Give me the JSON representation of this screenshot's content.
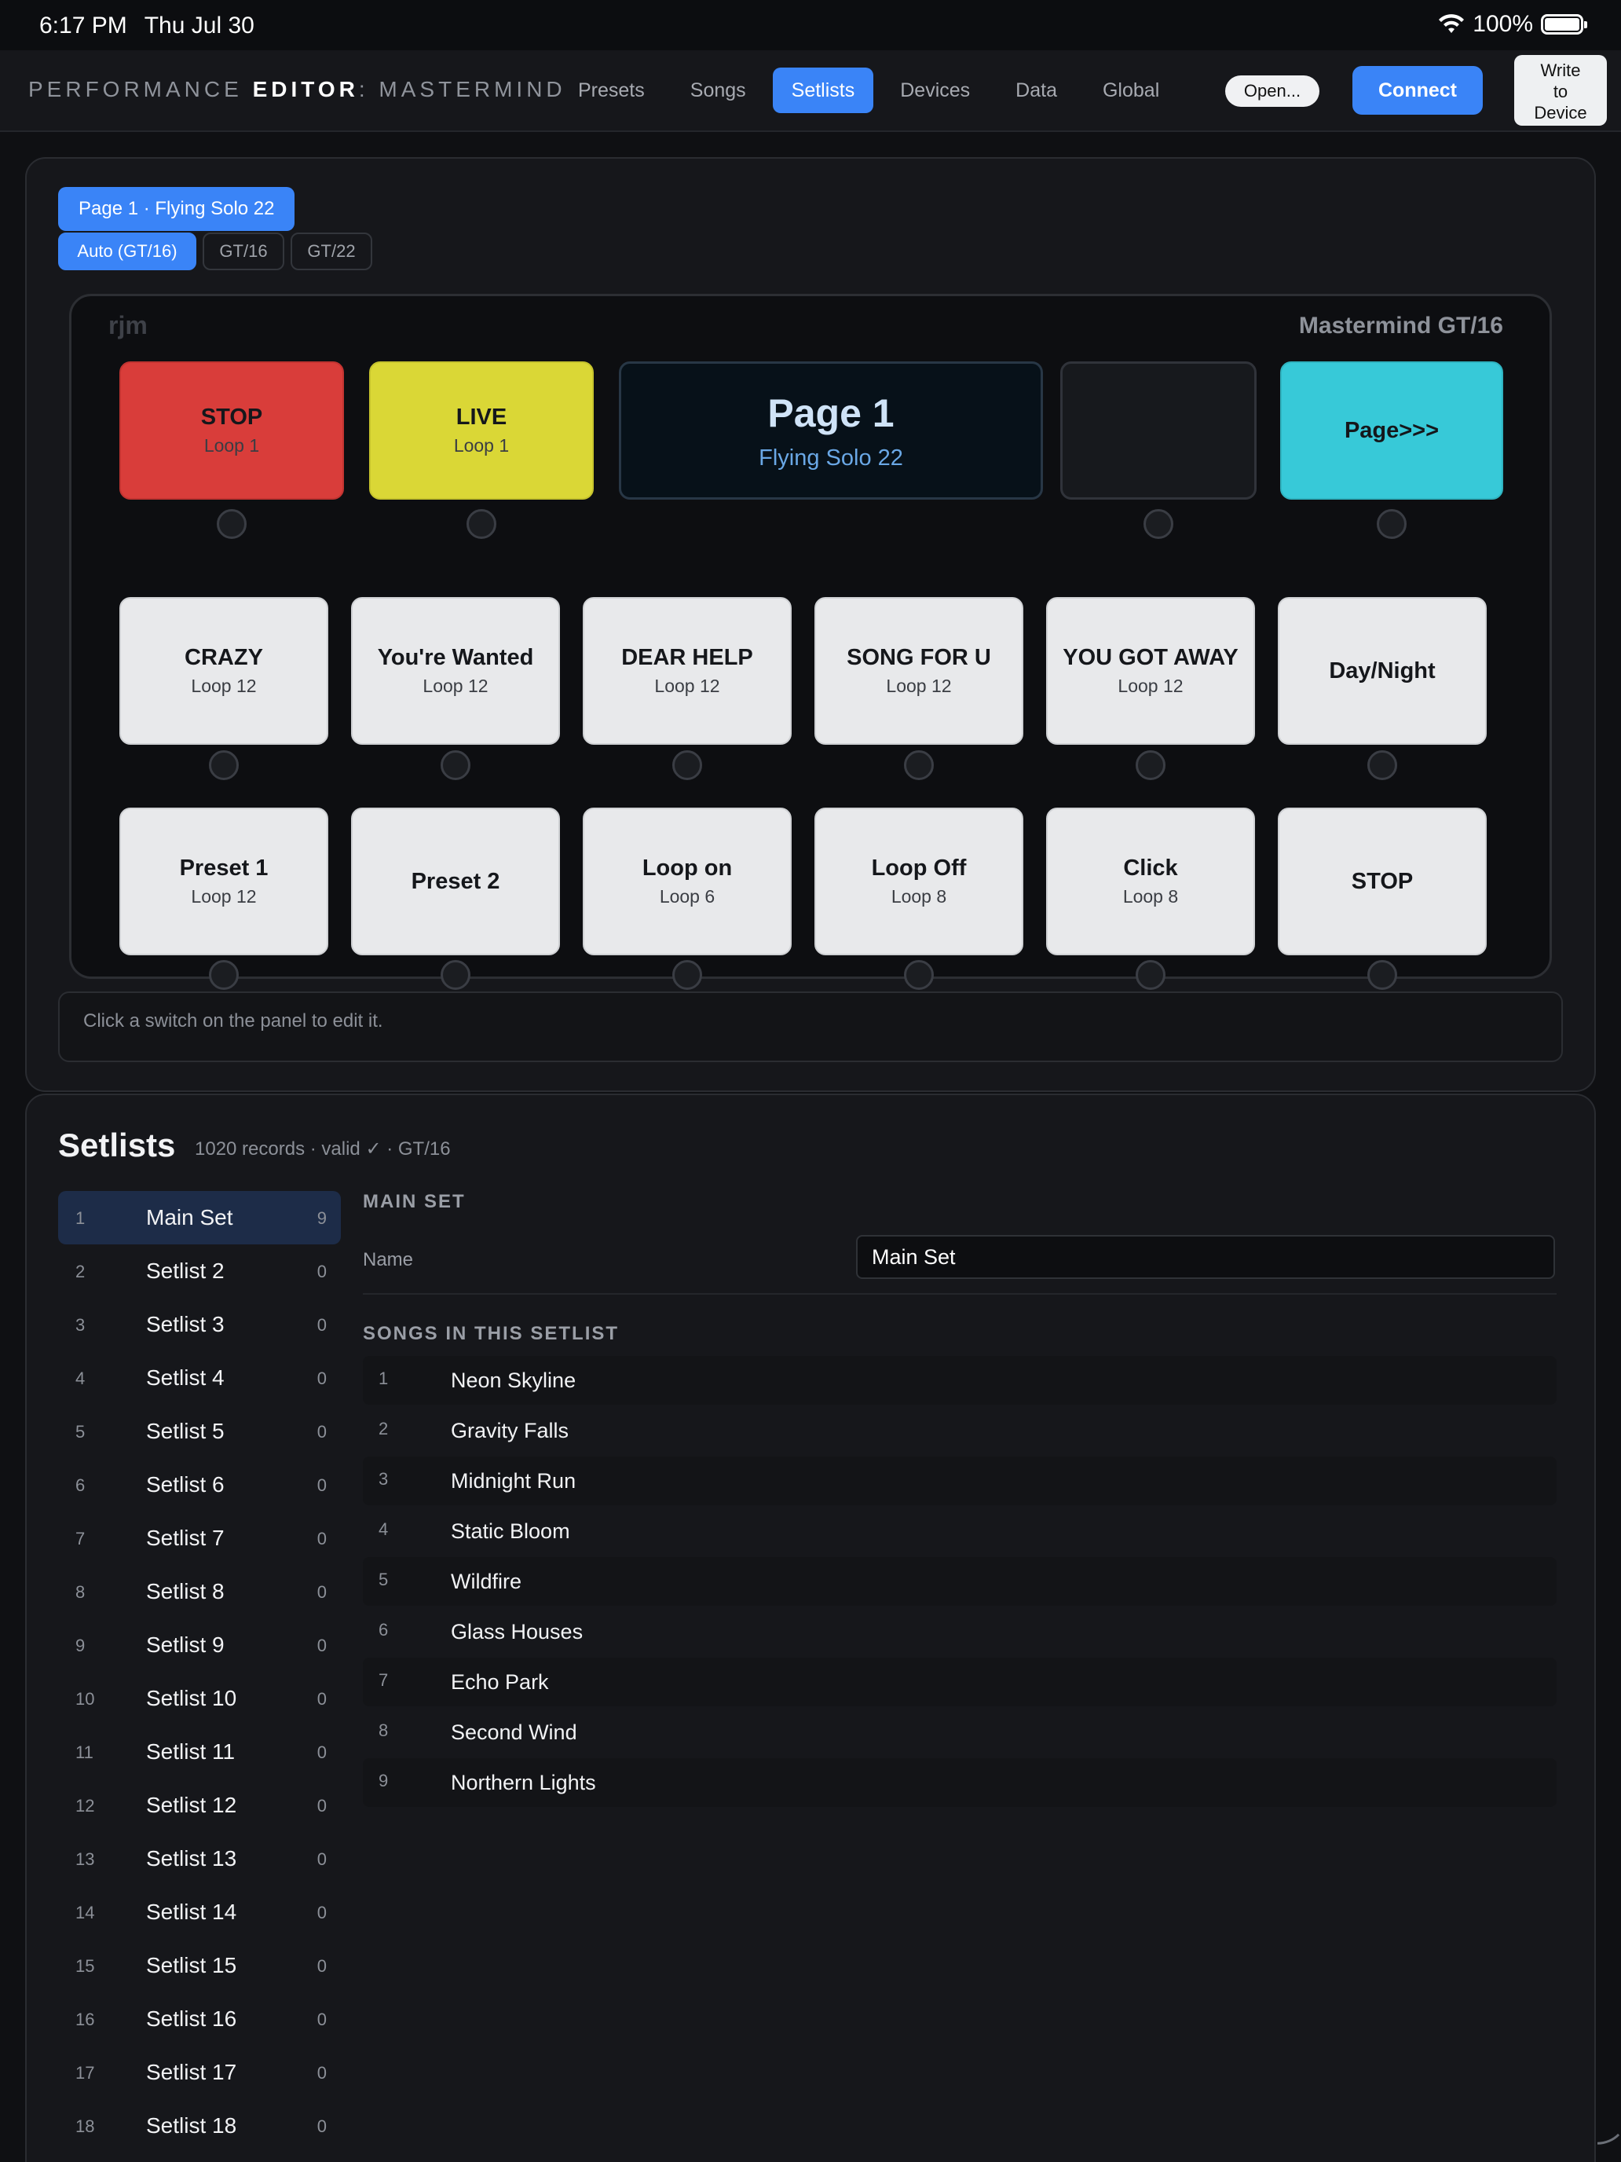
{
  "status": {
    "time": "6:17 PM",
    "date": "Thu Jul 30",
    "battery": "100%"
  },
  "app": {
    "brand_prefix": "PERFORMANCE ",
    "brand_bold": "EDITOR",
    "brand_suffix": ": MASTERMIND"
  },
  "nav": {
    "tabs": [
      "Presets",
      "Songs",
      "Setlists",
      "Devices",
      "Data",
      "Global"
    ],
    "active": "Setlists"
  },
  "actions": {
    "open": "Open...",
    "connect": "Connect",
    "write": "Write\nto\nDevice"
  },
  "panel": {
    "page_chip": "Page 1 · Flying Solo 22",
    "layouts": [
      "Auto (GT/16)",
      "GT/16",
      "GT/22"
    ],
    "brand": "rjm",
    "model": "Mastermind GT/16",
    "top_row": [
      {
        "title": "STOP",
        "sub": "Loop 1",
        "color": "#d93d3a"
      },
      {
        "title": "LIVE",
        "sub": "Loop 1",
        "color": "#dad736"
      },
      {
        "title": "Page 1",
        "sub": "Flying Solo 22",
        "kind": "display"
      },
      {
        "title": "",
        "sub": "",
        "kind": "empty"
      },
      {
        "title": "Page>>>",
        "sub": "",
        "color": "#37c9d8"
      }
    ],
    "row2": [
      {
        "title": "CRAZY",
        "sub": "Loop 12"
      },
      {
        "title": "You're Wanted",
        "sub": "Loop 12"
      },
      {
        "title": "DEAR HELP",
        "sub": "Loop 12"
      },
      {
        "title": "SONG FOR U",
        "sub": "Loop 12"
      },
      {
        "title": "YOU GOT AWAY",
        "sub": "Loop 12"
      },
      {
        "title": "Day/Night",
        "sub": ""
      }
    ],
    "row3": [
      {
        "title": "Preset 1",
        "sub": "Loop 12"
      },
      {
        "title": "Preset 2",
        "sub": ""
      },
      {
        "title": "Loop on",
        "sub": "Loop 6"
      },
      {
        "title": "Loop Off",
        "sub": "Loop 8"
      },
      {
        "title": "Click",
        "sub": "Loop 8"
      },
      {
        "title": "STOP",
        "sub": ""
      }
    ],
    "hint": "Click a switch on the panel to edit it."
  },
  "setlists": {
    "title": "Setlists",
    "meta": "1020 records · valid ✓ · GT/16",
    "items": [
      {
        "num": "1",
        "name": "Main Set",
        "count": "9"
      },
      {
        "num": "2",
        "name": "Setlist 2",
        "count": "0"
      },
      {
        "num": "3",
        "name": "Setlist 3",
        "count": "0"
      },
      {
        "num": "4",
        "name": "Setlist 4",
        "count": "0"
      },
      {
        "num": "5",
        "name": "Setlist 5",
        "count": "0"
      },
      {
        "num": "6",
        "name": "Setlist 6",
        "count": "0"
      },
      {
        "num": "7",
        "name": "Setlist 7",
        "count": "0"
      },
      {
        "num": "8",
        "name": "Setlist 8",
        "count": "0"
      },
      {
        "num": "9",
        "name": "Setlist 9",
        "count": "0"
      },
      {
        "num": "10",
        "name": "Setlist 10",
        "count": "0"
      },
      {
        "num": "11",
        "name": "Setlist 11",
        "count": "0"
      },
      {
        "num": "12",
        "name": "Setlist 12",
        "count": "0"
      },
      {
        "num": "13",
        "name": "Setlist 13",
        "count": "0"
      },
      {
        "num": "14",
        "name": "Setlist 14",
        "count": "0"
      },
      {
        "num": "15",
        "name": "Setlist 15",
        "count": "0"
      },
      {
        "num": "16",
        "name": "Setlist 16",
        "count": "0"
      },
      {
        "num": "17",
        "name": "Setlist 17",
        "count": "0"
      },
      {
        "num": "18",
        "name": "Setlist 18",
        "count": "0"
      }
    ],
    "detail": {
      "heading": "MAIN SET",
      "name_label": "Name",
      "name_value": "Main Set",
      "songs_heading": "SONGS IN THIS SETLIST",
      "songs": [
        "Neon Skyline",
        "Gravity Falls",
        "Midnight Run",
        "Static Bloom",
        "Wildfire",
        "Glass Houses",
        "Echo Park",
        "Second Wind",
        "Northern Lights"
      ]
    }
  }
}
